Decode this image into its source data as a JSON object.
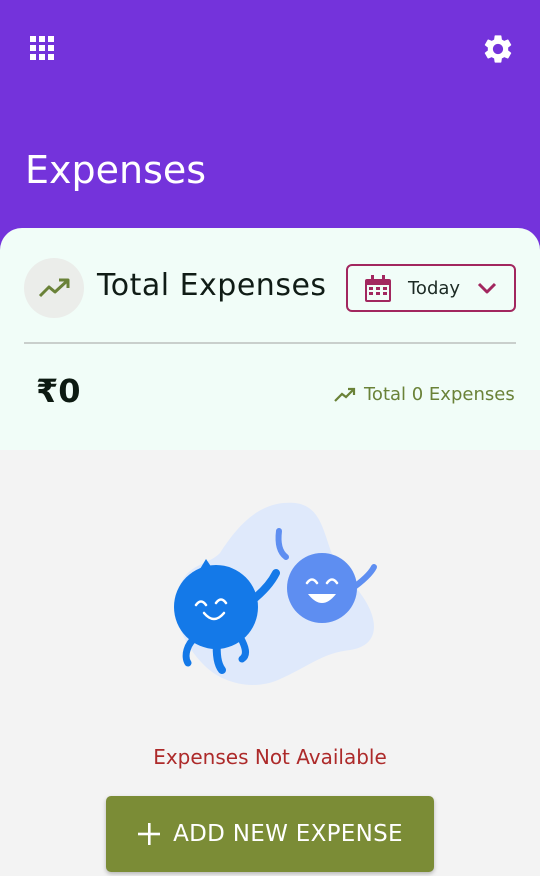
{
  "header": {
    "title": "Expenses",
    "background_color": "#7433db",
    "left_icon": "apps-grid-icon",
    "right_icon": "gear-icon"
  },
  "summary_card": {
    "title": "Total Expenses",
    "trend_icon": "trending-up-icon",
    "date_filter": {
      "selected": "Today",
      "icon": "calendar-icon",
      "dropdown_icon": "chevron-down-icon",
      "accent_color": "#a2275f"
    },
    "amount": "₹0",
    "count_text": "Total 0 Expenses"
  },
  "empty_state": {
    "illustration": "two-happy-blobs-illustration",
    "message": "Expenses Not Available",
    "message_color": "#ad2a2a"
  },
  "actions": {
    "add_label": "ADD NEW EXPENSE",
    "add_icon": "plus-icon",
    "button_color": "#7b8c36"
  }
}
